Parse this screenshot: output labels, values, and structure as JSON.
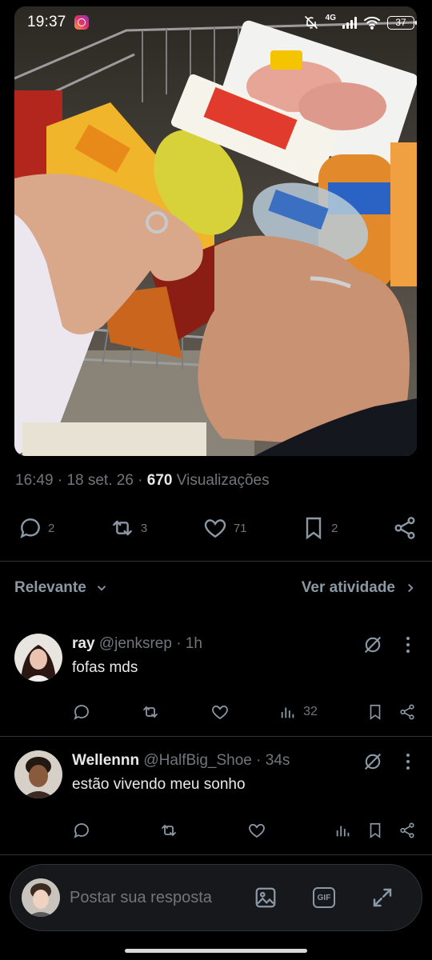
{
  "status": {
    "time": "19:37",
    "network": "4G",
    "battery": "37"
  },
  "post": {
    "time": "16:49",
    "date": "18 set. 26",
    "views": "670",
    "views_label": "Visualizações",
    "replies": "2",
    "reposts": "3",
    "likes": "71",
    "bookmarks": "2"
  },
  "sort": {
    "label": "Relevante",
    "activity": "Ver atividade"
  },
  "replies": [
    {
      "name": "ray",
      "handle": "@jenksrep",
      "time": "1h",
      "text": "fofas mds",
      "views": "32"
    },
    {
      "name": "Wellennn",
      "handle": "@HalfBig_Shoe",
      "time": "34s",
      "text": "estão vivendo meu sonho",
      "views": ""
    }
  ],
  "composer": {
    "placeholder": "Postar sua resposta",
    "gif_label": "GIF"
  },
  "icons": {
    "reply": "speech-bubble-icon",
    "repost": "repost-arrows-icon",
    "like": "heart-icon",
    "bookmark": "bookmark-icon",
    "share": "share-icon",
    "views": "bar-chart-icon",
    "grok": "grok-slash-icon",
    "more": "vertical-dots-icon",
    "image": "image-icon",
    "expand": "expand-arrows-icon"
  }
}
